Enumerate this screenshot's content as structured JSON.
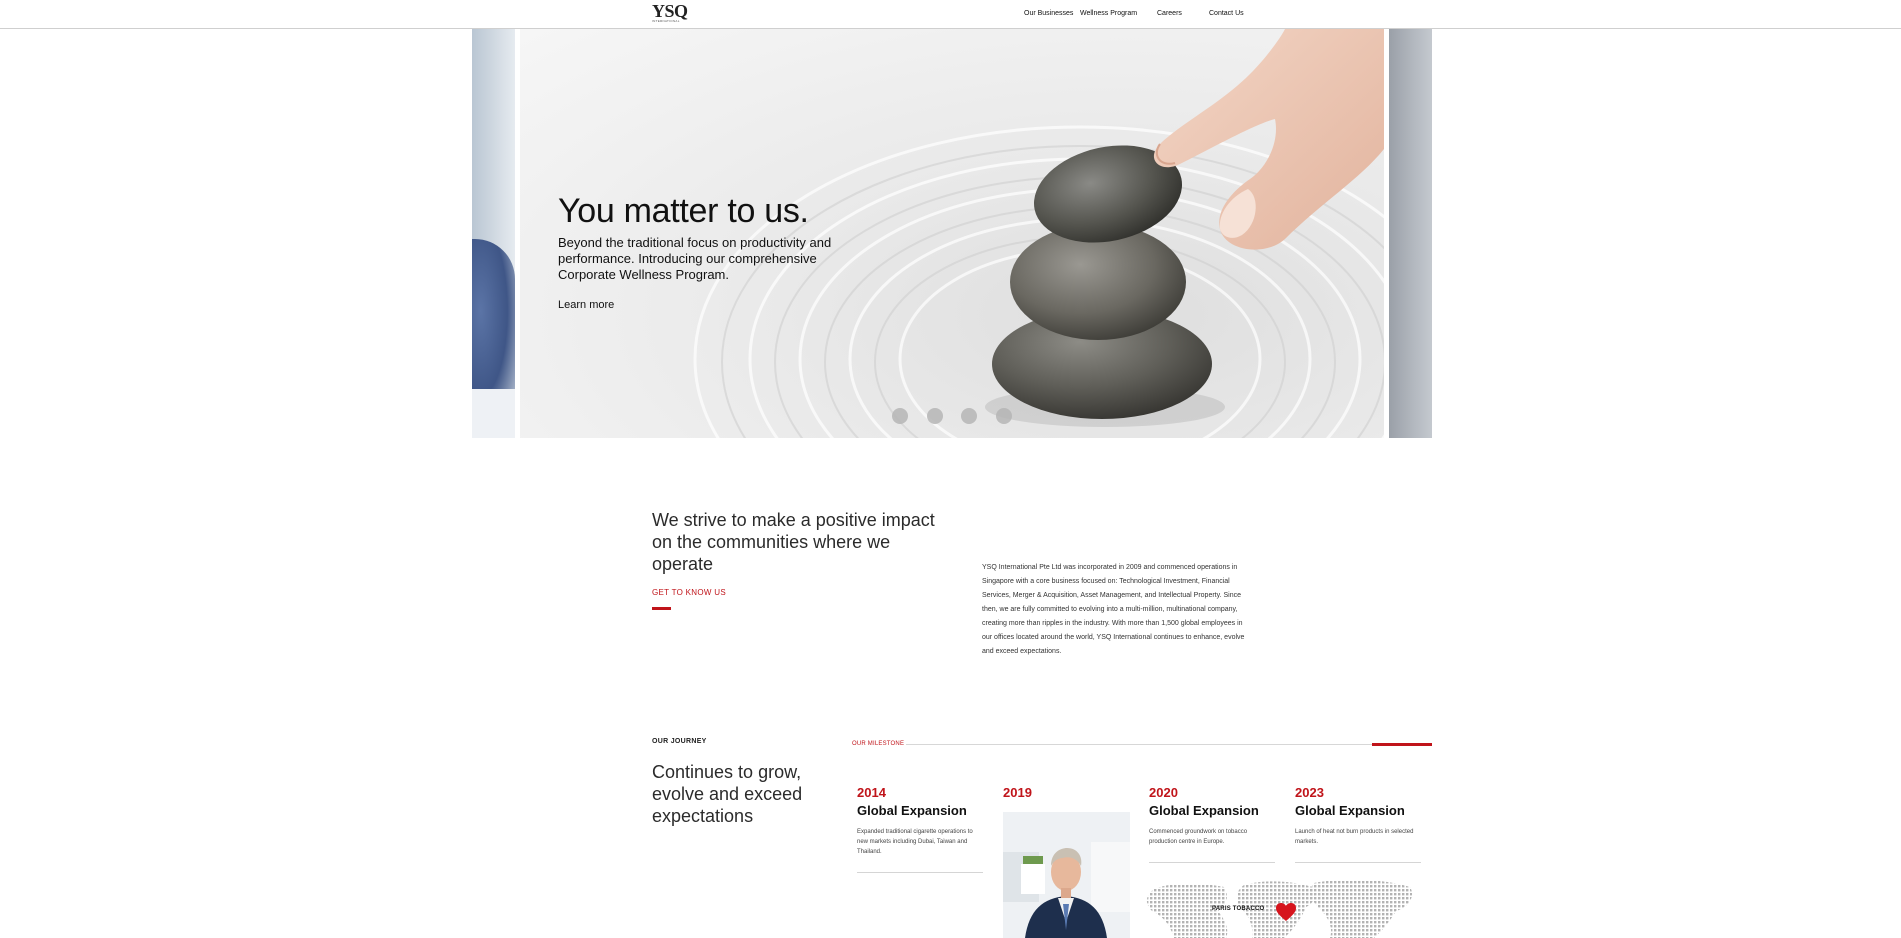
{
  "header": {
    "logo": "YSQ",
    "logo_sub": "INTERNATIONAL",
    "nav": [
      "Our Businesses",
      "Wellness Program",
      "Careers",
      "Contact Us"
    ]
  },
  "hero": {
    "title": "You matter to us.",
    "description": "Beyond the traditional focus on productivity and performance. Introducing our comprehensive Corporate Wellness Program.",
    "link": "Learn more",
    "slide_count": 4
  },
  "intro": {
    "heading": "We strive to make a positive impact on the communities where we operate",
    "link": "GET TO KNOW US",
    "body": "YSQ International Pte Ltd was incorporated in 2009 and commenced operations in Singapore with a core business focused on: Technological Investment, Financial Services, Merger & Acquisition, Asset Management, and Intellectual Property. Since then, we are fully committed to evolving into a multi-million, multinational company, creating more than ripples in the industry. With more than 1,500 global employees in our offices located around the world, YSQ International continues to enhance, evolve and exceed expectations."
  },
  "journey": {
    "label": "OUR JOURNEY",
    "heading": "Continues to grow, evolve and exceed expectations",
    "milestone_label": "OUR MILESTONE",
    "milestones": [
      {
        "year": "2014",
        "title": "Global Expansion",
        "desc": "Expanded traditional cigarette operations to new markets including Dubai, Taiwan and Thailand."
      },
      {
        "year": "2019",
        "title": "",
        "desc": ""
      },
      {
        "year": "2020",
        "title": "Global Expansion",
        "desc": "Commenced groundwork on tobacco production centre in Europe."
      },
      {
        "year": "2023",
        "title": "Global Expansion",
        "desc": "Launch of heat not burn products in selected markets."
      }
    ],
    "map_label": "PARIS TOBACCO"
  },
  "colors": {
    "accent": "#c0141a",
    "text": "#111111",
    "rule": "#d5d5d5"
  }
}
